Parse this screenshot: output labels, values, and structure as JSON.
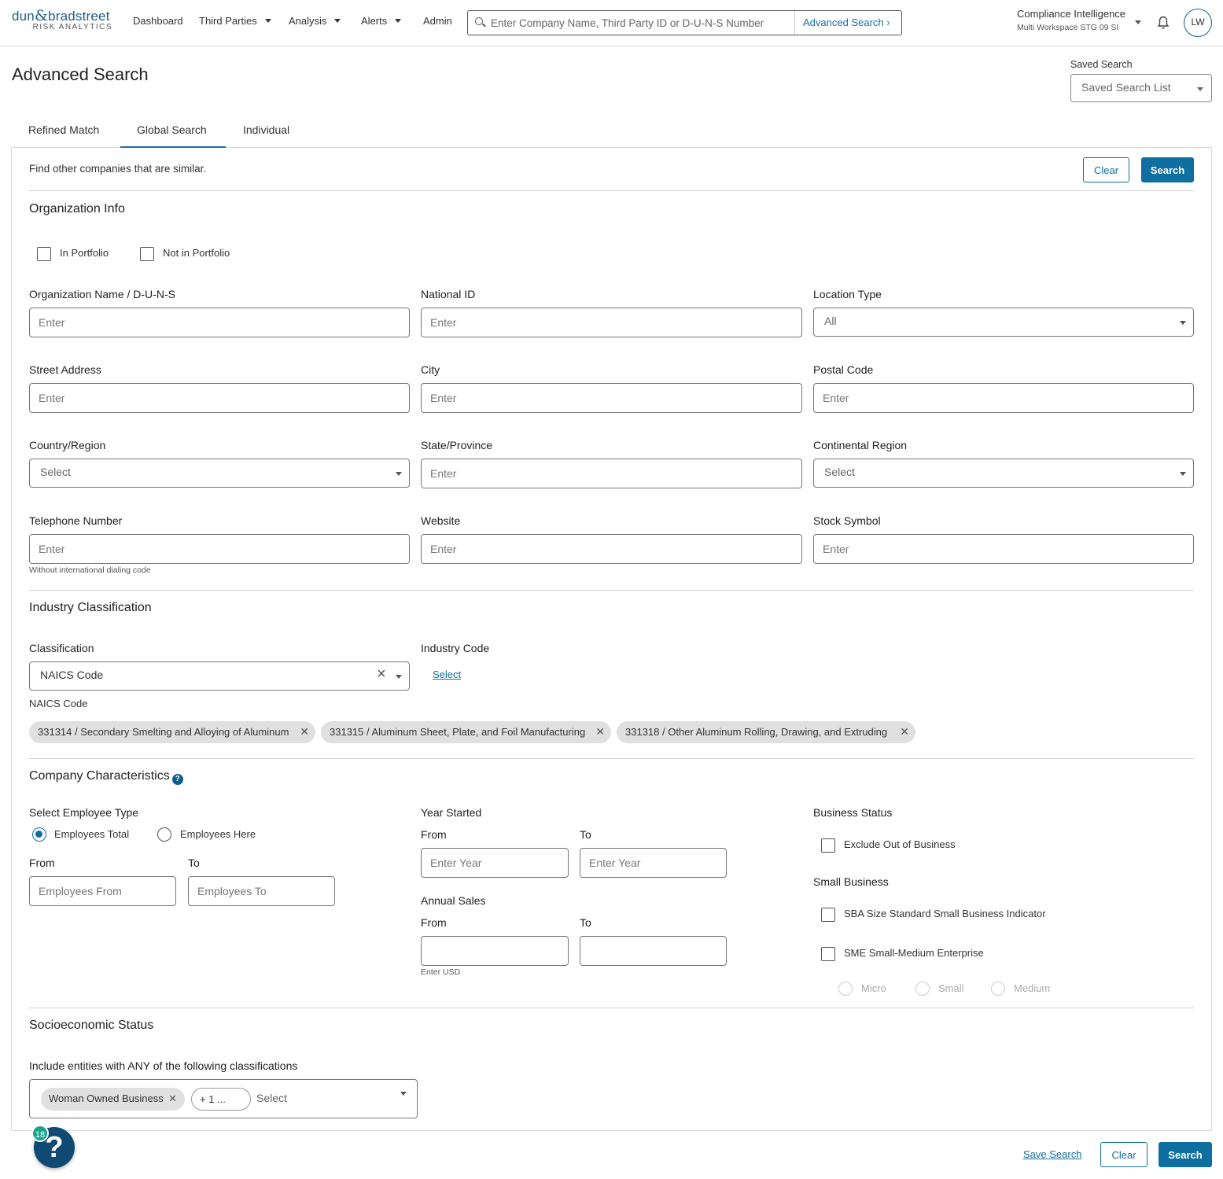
{
  "header": {
    "logo_main": "dun",
    "logo_amp": "&",
    "logo_second": "bradstreet",
    "logo_sub": "RISK ANALYTICS",
    "nav": [
      "Dashboard",
      "Third Parties",
      "Analysis",
      "Alerts",
      "Admin"
    ],
    "search_placeholder": "Enter Company Name, Third Party ID or D-U-N-S Number",
    "advanced_search": "Advanced Search ›",
    "product": "Compliance Intelligence",
    "workspace": "Multi Workspace STG 09 SI",
    "avatar": "LW"
  },
  "page": {
    "title": "Advanced Search",
    "saved_search_label": "Saved Search",
    "saved_search_value": "Saved Search List"
  },
  "tabs": [
    "Refined Match",
    "Global Search",
    "Individual"
  ],
  "top": {
    "description": "Find other companies that are similar.",
    "clear": "Clear",
    "search": "Search"
  },
  "org": {
    "title": "Organization Info",
    "in_portfolio": "In Portfolio",
    "not_in_portfolio": "Not in Portfolio",
    "org_name_label": "Organization Name / D-U-N-S",
    "national_id_label": "National ID",
    "location_type_label": "Location Type",
    "location_type_value": "All",
    "street_label": "Street Address",
    "city_label": "City",
    "postal_label": "Postal Code",
    "country_label": "Country/Region",
    "country_value": "Select",
    "state_label": "State/Province",
    "continental_label": "Continental Region",
    "continental_value": "Select",
    "telephone_label": "Telephone Number",
    "telephone_note": "Without international dialing code",
    "website_label": "Website",
    "stock_label": "Stock Symbol",
    "enter": "Enter"
  },
  "industry": {
    "title": "Industry Classification",
    "classification_label": "Classification",
    "classification_value": "NAICS Code",
    "industry_code_label": "Industry Code",
    "select_link": "Select",
    "codes_label": "NAICS Code",
    "chips": [
      "331314 / Secondary Smelting and Alloying of Aluminum",
      "331315 / Aluminum Sheet, Plate, and Foil Manufacturing",
      "331318 / Other Aluminum Rolling, Drawing, and Extruding"
    ]
  },
  "company": {
    "title": "Company Characteristics",
    "employee_type_label": "Select Employee Type",
    "employees_total": "Employees Total",
    "employees_here": "Employees Here",
    "from": "From",
    "to": "To",
    "employees_from": "Employees From",
    "employees_to": "Employees To",
    "year_started": "Year Started",
    "enter_year": "Enter Year",
    "annual_sales": "Annual Sales",
    "enter_usd": "Enter USD",
    "business_status": "Business Status",
    "exclude_oob": "Exclude Out of Business",
    "small_business": "Small Business",
    "sba": "SBA Size Standard Small Business Indicator",
    "sme": "SME Small-Medium Enterprise",
    "micro": "Micro",
    "small": "Small",
    "medium": "Medium"
  },
  "socio": {
    "title": "Socioeconomic Status",
    "include_label": "Include entities with ANY of the following classifications",
    "chip": "Woman Owned Business",
    "more": "+ 1 ...",
    "select": "Select"
  },
  "footer": {
    "save_search": "Save Search",
    "clear": "Clear",
    "search": "Search",
    "help_badge": "18",
    "help_icon": "?"
  }
}
